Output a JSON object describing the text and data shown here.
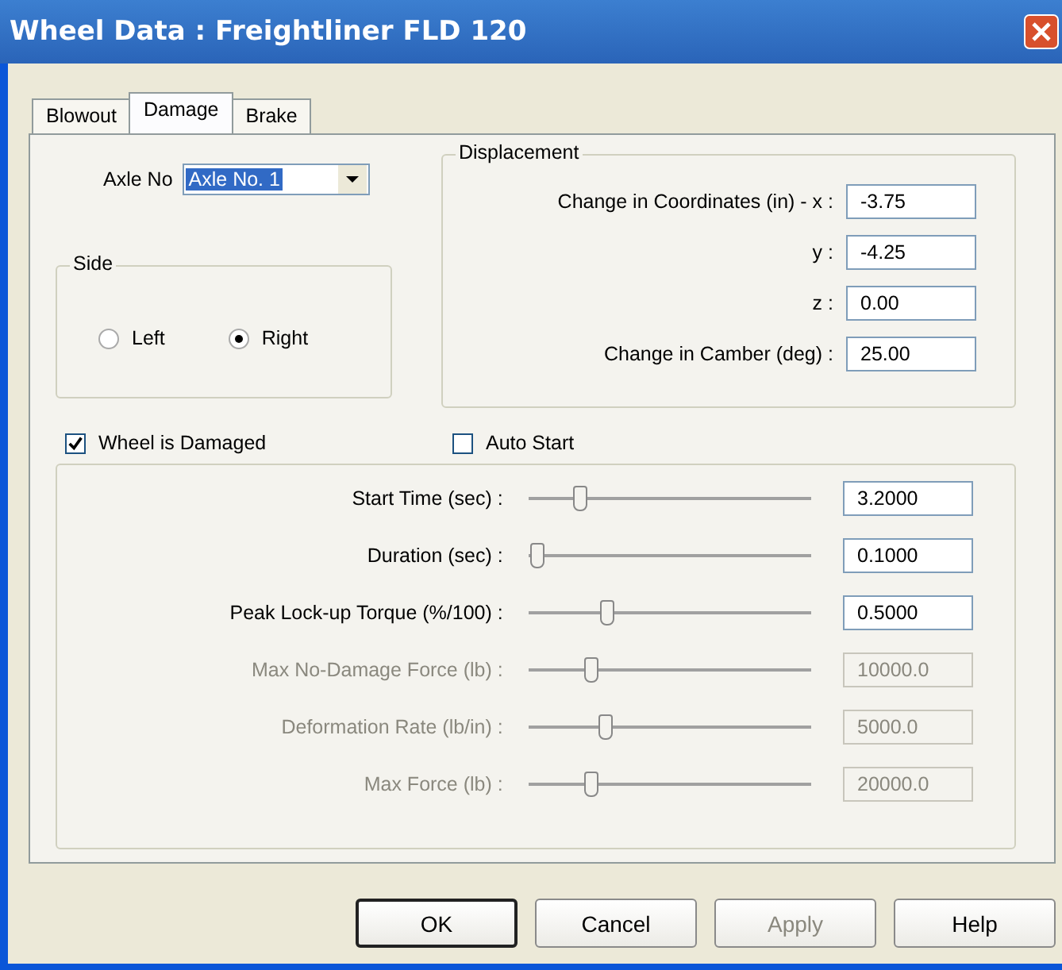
{
  "window": {
    "title": "Wheel Data : Freightliner FLD 120"
  },
  "tabs": [
    {
      "label": "Blowout",
      "selected": false
    },
    {
      "label": "Damage",
      "selected": true
    },
    {
      "label": "Brake",
      "selected": false
    }
  ],
  "axle": {
    "label": "Axle No",
    "value": "Axle No. 1"
  },
  "side": {
    "title": "Side",
    "options": [
      {
        "label": "Left",
        "selected": false
      },
      {
        "label": "Right",
        "selected": true
      }
    ]
  },
  "displacement": {
    "title": "Displacement",
    "fields": [
      {
        "label": "Change in Coordinates (in) - x :",
        "value": "-3.75"
      },
      {
        "label": "y :",
        "value": "-4.25"
      },
      {
        "label": "z :",
        "value": "0.00"
      },
      {
        "label": "Change in Camber (deg) :",
        "value": "25.00"
      }
    ]
  },
  "checkboxes": [
    {
      "label": "Wheel is Damaged",
      "checked": true
    },
    {
      "label": "Auto Start",
      "checked": false
    }
  ],
  "sliders": [
    {
      "label": "Start Time (sec) :",
      "level": 0.17,
      "value": "3.2000",
      "disabled": false
    },
    {
      "label": "Duration (sec) :",
      "level": 0.02,
      "value": "0.1000",
      "disabled": false
    },
    {
      "label": "Peak Lock-up Torque (%/100) :",
      "level": 0.27,
      "value": "0.5000",
      "disabled": false
    },
    {
      "label": "Max No-Damage Force (lb) :",
      "level": 0.21,
      "value": "10000.0",
      "disabled": true
    },
    {
      "label": "Deformation Rate (lb/in) :",
      "level": 0.26,
      "value": "5000.0",
      "disabled": true
    },
    {
      "label": "Max Force (lb) :",
      "level": 0.21,
      "value": "20000.0",
      "disabled": true
    }
  ],
  "buttons": [
    {
      "label": "OK",
      "default": true,
      "disabled": false
    },
    {
      "label": "Cancel",
      "default": false,
      "disabled": false
    },
    {
      "label": "Apply",
      "default": false,
      "disabled": true
    },
    {
      "label": "Help",
      "default": false,
      "disabled": false
    }
  ]
}
